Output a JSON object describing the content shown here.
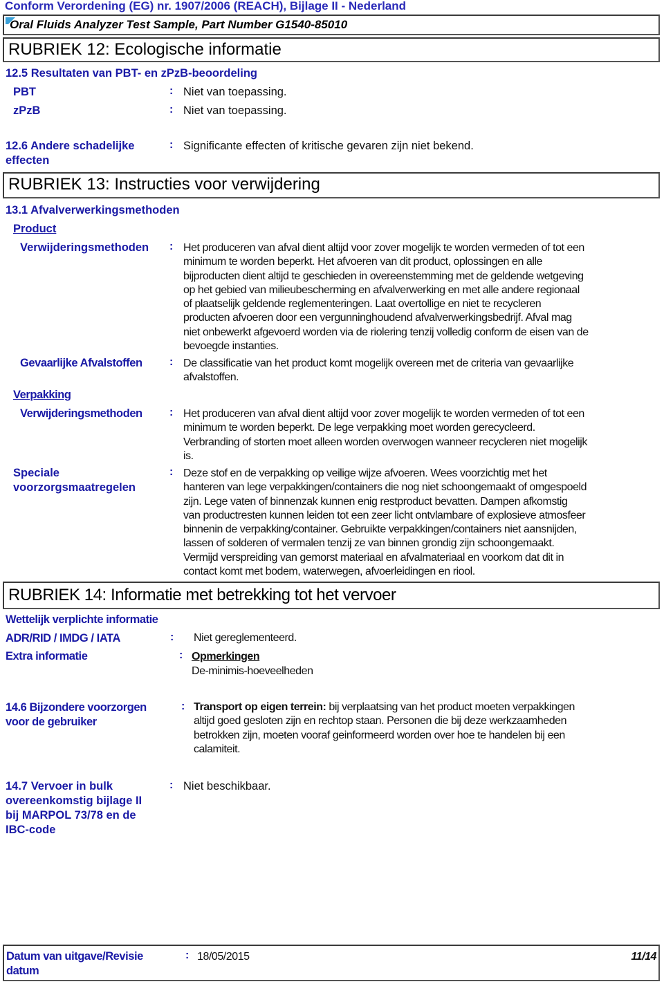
{
  "header": {
    "regulation": "Conform Verordening (EG) nr. 1907/2006 (REACH), Bijlage II - Nederland",
    "product_name": "Oral Fluids Analyzer Test Sample, Part Number G1540-85010",
    "icon": "check-mark-icon"
  },
  "section12": {
    "title": "RUBRIEK 12: Ecologische informatie",
    "sub125": {
      "heading": "12.5 Resultaten van PBT- en zPzB-beoordeling",
      "rows": [
        {
          "label": "PBT",
          "value": "Niet van toepassing."
        },
        {
          "label": "zPzB",
          "value": "Niet van toepassing."
        }
      ]
    },
    "sub126": {
      "label_line1": "12.6 Andere schadelijke",
      "label_line2": "effecten",
      "value": "Significante effecten of kritische gevaren zijn niet bekend."
    }
  },
  "section13": {
    "title": "RUBRIEK 13: Instructies voor verwijdering",
    "sub131": "13.1 Afvalverwerkingsmethoden",
    "product": {
      "heading": "Product",
      "methods_label": "Verwijderingsmethoden",
      "methods_lines": [
        "Het produceren van afval dient altijd voor zover mogelijk te worden vermeden of tot een",
        "minimum te worden beperkt.  Het afvoeren van dit product, oplossingen en alle",
        "bijproducten dient altijd te geschieden in overeenstemming met de geldende wetgeving",
        "op het gebied van milieubescherming en afvalverwerking en met alle andere regionaal",
        "of plaatselijk geldende reglementeringen.  Laat overtollige en niet te recycleren",
        "producten afvoeren door een vergunninghoudend afvalverwerkingsbedrijf.  Afval mag",
        "niet onbewerkt afgevoerd worden via de riolering tenzij volledig conform de eisen van de",
        "bevoegde instanties."
      ],
      "hazardous_label": "Gevaarlijke Afvalstoffen",
      "hazardous_lines": [
        "De classificatie van het product komt mogelijk overeen met de criteria van gevaarlijke",
        "afvalstoffen."
      ]
    },
    "packaging": {
      "heading": "Verpakking",
      "methods_label": "Verwijderingsmethoden",
      "methods_lines": [
        "Het produceren van afval dient altijd voor zover mogelijk te worden vermeden of tot een",
        "minimum te worden beperkt.  De lege verpakking moet worden gerecycleerd.",
        "Verbranding of storten moet alleen worden overwogen wanneer recycleren niet mogelijk",
        "is."
      ]
    },
    "special": {
      "label_line1": "Speciale",
      "label_line2": "voorzorgsmaatregelen",
      "lines": [
        "Deze stof en de verpakking op veilige wijze afvoeren.  Wees voorzichtig met het",
        "hanteren van lege verpakkingen/containers die nog niet schoongemaakt of omgespoeld",
        "zijn.  Lege vaten of binnenzak kunnen enig restproduct bevatten.  Dampen afkomstig",
        "van productresten kunnen leiden tot een zeer licht ontvlambare of explosieve atmosfeer",
        "binnenin de verpakking/container.  Gebruikte verpakkingen/containers niet aansnijden,",
        "lassen of solderen of vermalen tenzij ze van binnen grondig zijn schoongemaakt.",
        "Vermijd verspreiding van gemorst materiaal en afvalmateriaal en voorkom dat dit in",
        "contact komt met bodem, waterwegen, afvoerleidingen en riool."
      ]
    }
  },
  "section14": {
    "title": "RUBRIEK 14: Informatie met betrekking tot het vervoer",
    "legal_heading": "Wettelijk verplichte informatie",
    "adr_label": "ADR/RID / IMDG / IATA",
    "adr_value": "Niet gereglementeerd.",
    "extra_label": "Extra informatie",
    "extra_heading": "Opmerkingen",
    "extra_value": "De-minimis-hoeveelheden",
    "sub146": {
      "label_line1": "14.6 Bijzondere voorzorgen",
      "label_line2": "voor de gebruiker",
      "bold_lead": "Transport op eigen terrein:",
      "line1_rest": " bij verplaatsing van het product moeten verpakkingen",
      "lines": [
        "altijd goed gesloten zijn en rechtop staan. Personen die bij deze werkzaamheden",
        "betrokken zijn, moeten vooraf geinformeerd worden over hoe te handelen bij een",
        "calamiteit."
      ]
    },
    "sub147": {
      "label_lines": [
        "14.7 Vervoer in bulk",
        "overeenkomstig bijlage II",
        "bij MARPOL 73/78 en de",
        "IBC-code"
      ],
      "value": "Niet beschikbaar."
    }
  },
  "footer": {
    "date_label_line1": "Datum van uitgave/Revisie",
    "date_label_line2": "datum",
    "date_value": "18/05/2015",
    "page": "11/14"
  },
  "separator": ":"
}
